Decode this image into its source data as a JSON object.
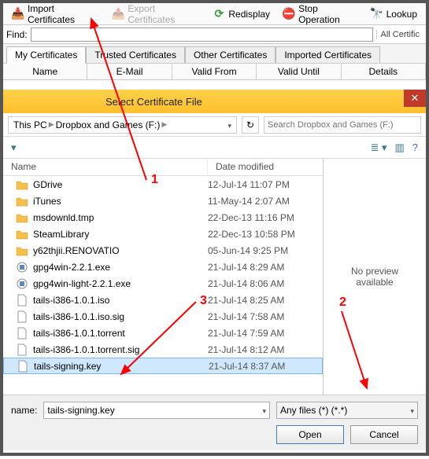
{
  "toolbar": {
    "import": "Import Certificates",
    "export": "Export Certificates",
    "redisplay": "Redisplay",
    "stop": "Stop Operation",
    "lookup": "Lookup"
  },
  "find": {
    "label": "Find:",
    "value": "",
    "right": "All Certific"
  },
  "tabs": [
    "My Certificates",
    "Trusted Certificates",
    "Other Certificates",
    "Imported Certificates"
  ],
  "cols": [
    "Name",
    "E-Mail",
    "Valid From",
    "Valid Until",
    "Details"
  ],
  "dialog": {
    "title": "Select Certificate File",
    "path1": "This PC",
    "path2": "Dropbox and Games (F:)",
    "refresh": "↻",
    "search_placeholder": "Search Dropbox and Games (F:)",
    "view_icons": {
      "org": "▾",
      "view": "≣ ▾",
      "pane": "▥",
      "help": "?"
    },
    "listcols": {
      "name": "Name",
      "date": "Date modified"
    },
    "preview": "No preview available",
    "filename_label": "name:",
    "filename_value": "tails-signing.key",
    "filter": "Any files (*) (*.*)",
    "open": "Open",
    "cancel": "Cancel"
  },
  "files": [
    {
      "ic": "folder",
      "name": "GDrive",
      "date": "12-Jul-14 11:07 PM"
    },
    {
      "ic": "folder",
      "name": "iTunes",
      "date": "11-May-14 2:07 AM"
    },
    {
      "ic": "folder",
      "name": "msdownld.tmp",
      "date": "22-Dec-13 11:16 PM"
    },
    {
      "ic": "folder",
      "name": "SteamLibrary",
      "date": "22-Dec-13 10:58 PM"
    },
    {
      "ic": "folder",
      "name": "y62thjii.RENOVATIO",
      "date": "05-Jun-14 9:25 PM"
    },
    {
      "ic": "exe",
      "name": "gpg4win-2.2.1.exe",
      "date": "21-Jul-14 8:29 AM"
    },
    {
      "ic": "exe",
      "name": "gpg4win-light-2.2.1.exe",
      "date": "21-Jul-14 8:06 AM"
    },
    {
      "ic": "file",
      "name": "tails-i386-1.0.1.iso",
      "date": "21-Jul-14 8:25 AM"
    },
    {
      "ic": "file",
      "name": "tails-i386-1.0.1.iso.sig",
      "date": "21-Jul-14 7:58 AM"
    },
    {
      "ic": "file",
      "name": "tails-i386-1.0.1.torrent",
      "date": "21-Jul-14 7:59 AM"
    },
    {
      "ic": "file",
      "name": "tails-i386-1.0.1.torrent.sig",
      "date": "21-Jul-14 8:12 AM"
    },
    {
      "ic": "file",
      "name": "tails-signing.key",
      "date": "21-Jul-14 8:37 AM",
      "selected": true
    }
  ],
  "annotations": {
    "n1": "1",
    "n2": "2",
    "n3": "3"
  }
}
